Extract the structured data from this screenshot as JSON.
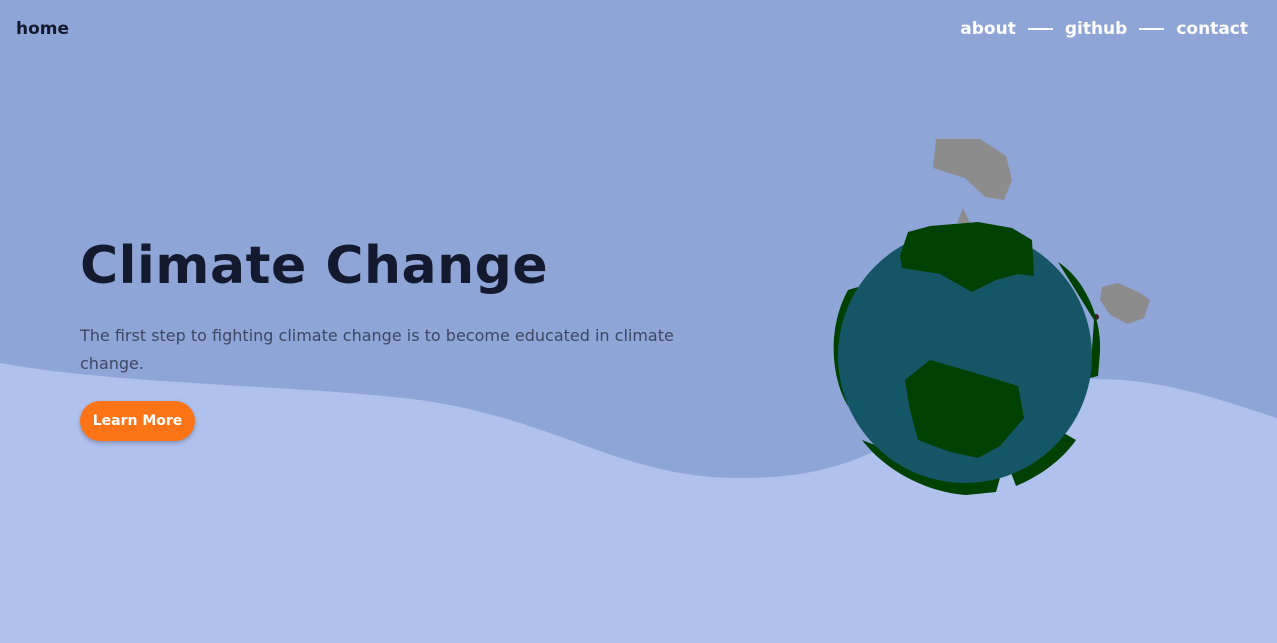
{
  "nav": {
    "home": "home",
    "links": [
      "about",
      "github",
      "contact"
    ]
  },
  "hero": {
    "title": "Climate Change",
    "description": "The first step to fighting climate change is to become educated in climate change.",
    "cta_label": "Learn More"
  },
  "colors": {
    "background_top": "#8fa5d7",
    "background_wave": "#b0c1ed",
    "accent_button": "#fc7416",
    "ocean": "#145566",
    "land": "#004000",
    "cloud": "#8c8c8c"
  },
  "icons": {
    "hero_illustration": "earth-globe-illustration"
  }
}
